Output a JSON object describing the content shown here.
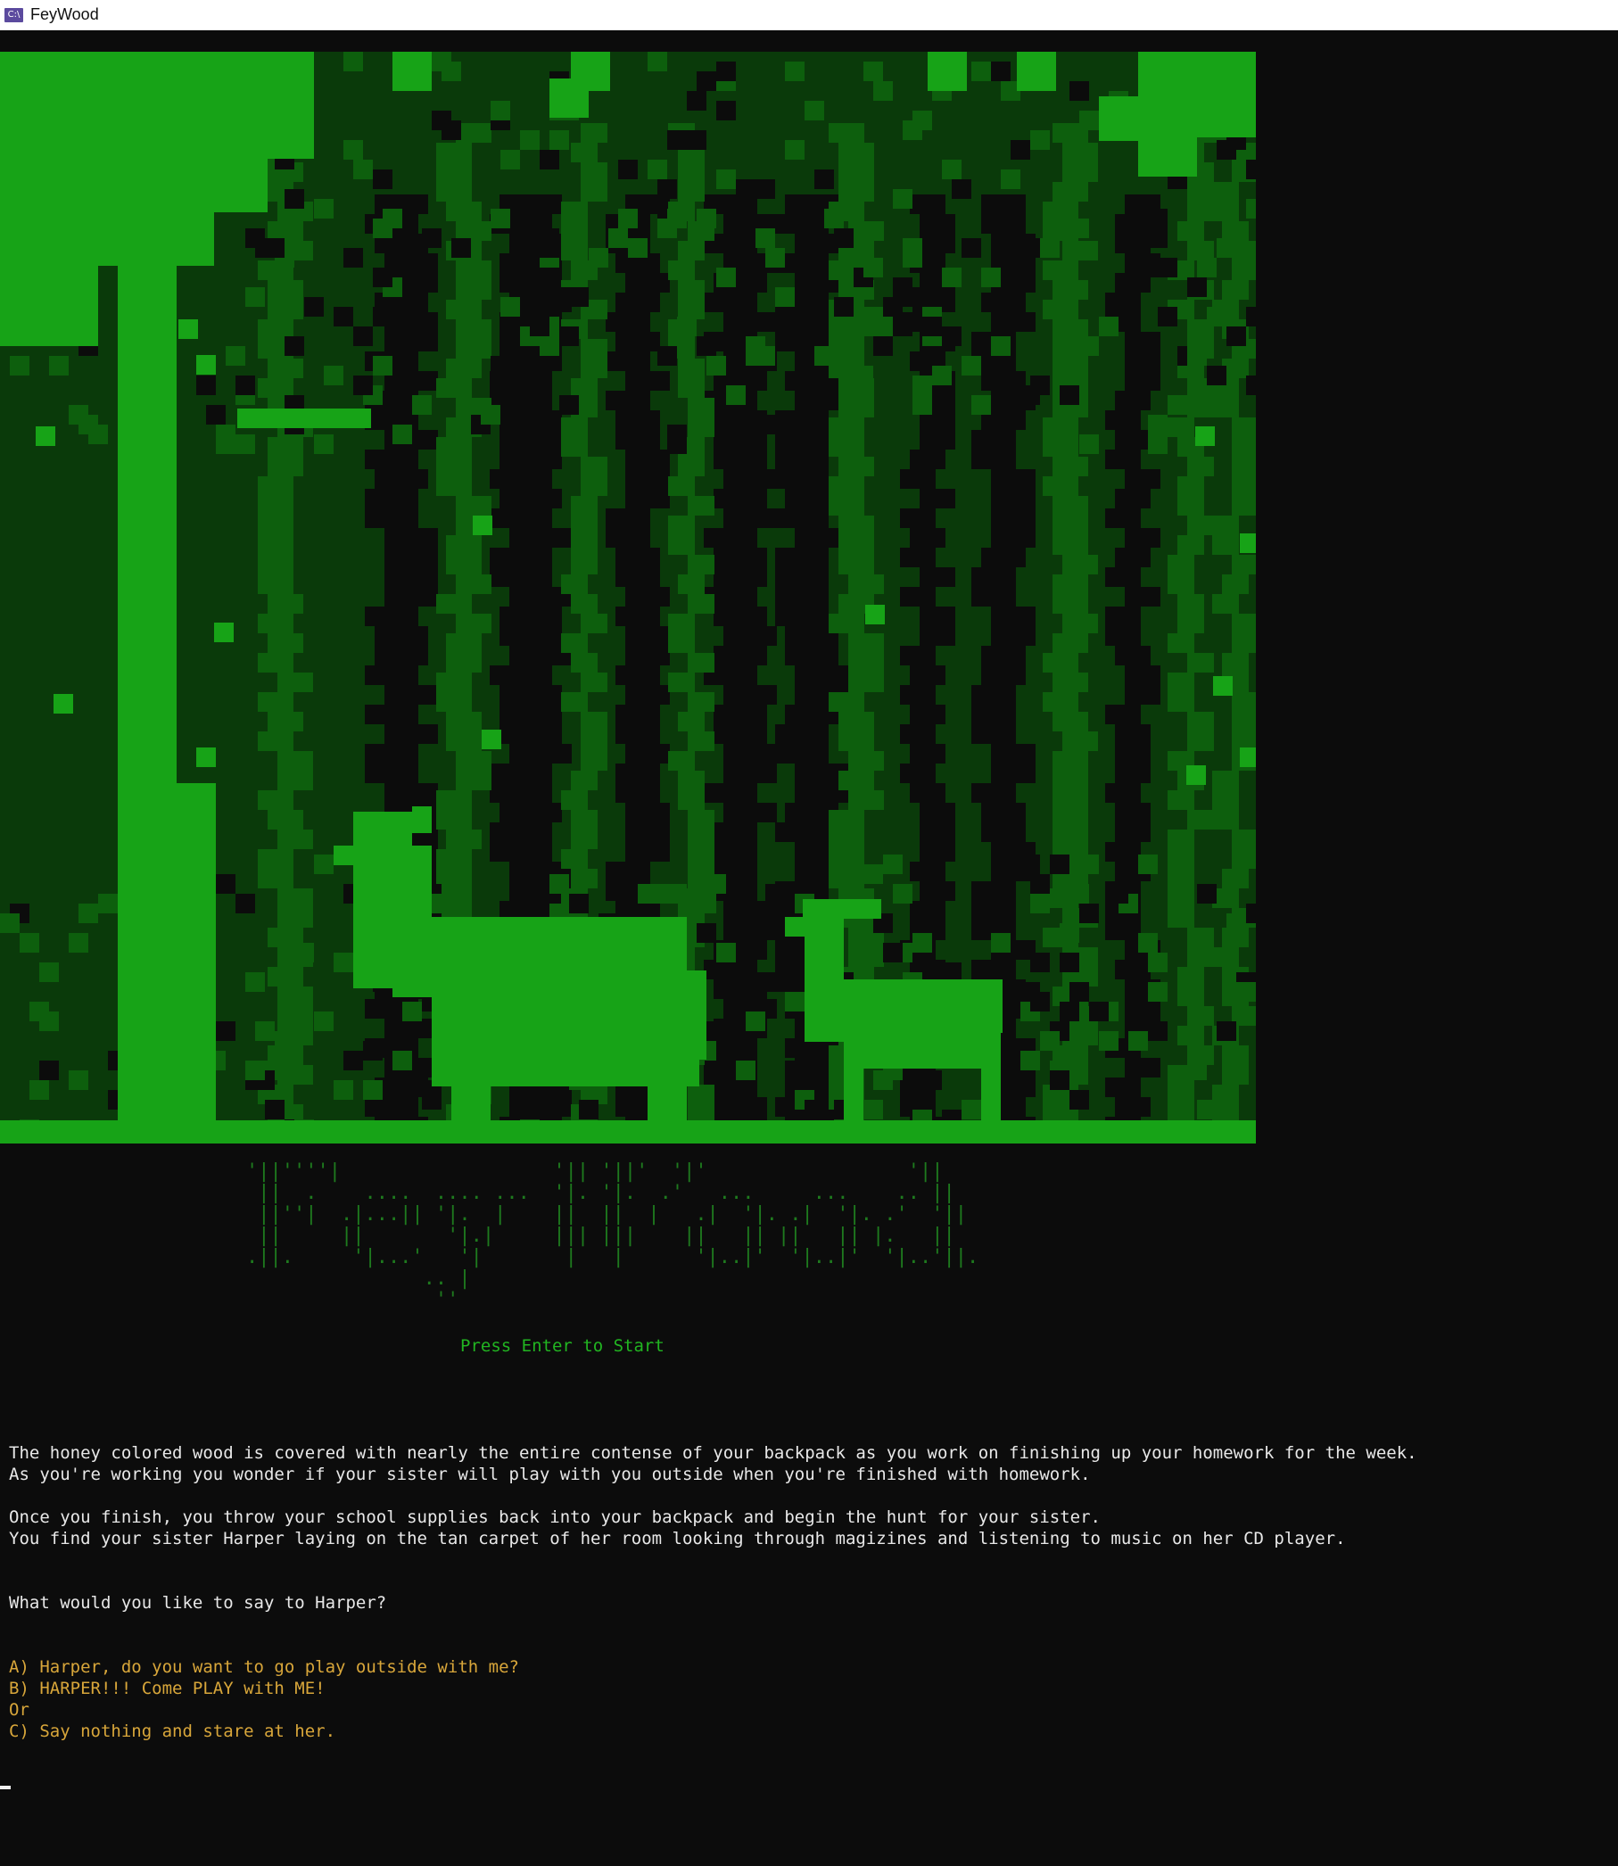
{
  "window": {
    "title": "FeyWood",
    "icon": "console-app-icon"
  },
  "art": {
    "palette": {
      "bright": "#17a317",
      "mid": "#0d5f0d",
      "dark": "#0a3a0a",
      "black": "#0c0c0c"
    }
  },
  "logo": {
    "lines": [
      "'||''''|                  '|| '||'  '|'                 '||",
      " ||  .    ....  .... ...  '|. '|.  .'   ...     ...    .. ||",
      " ||''|  .|...|| '|.  |    ||  ||  |   .|  '|. .|  '|. .'  '||",
      " ||     ||       '|.|     ||| |||    ||   || ||   || |.   ||",
      ".||.     '|...'   '|       |   |      '|..|'  '|..|'  '|..'||.",
      "               .. |",
      "                ''"
    ]
  },
  "prompt": {
    "start": "Press Enter to Start"
  },
  "story": {
    "line1": "The honey colored wood is covered with nearly the entire contense of your backpack as you work on finishing up your homework for the week.",
    "line2": "As you're working you wonder if your sister will play with you outside when you're finished with homework.",
    "line3": "Once you finish, you throw your school supplies back into your backpack and begin the hunt for your sister.",
    "line4": "You find your sister Harper laying on the tan carpet of her room looking through magizines and listening to music on her CD player.",
    "question": "What would you like to say to Harper?"
  },
  "options": {
    "a": "A) Harper, do you want to go play outside with me?",
    "b": "B) HARPER!!! Come PLAY with ME!",
    "or": "Or",
    "c": "C) Say nothing and stare at her."
  }
}
